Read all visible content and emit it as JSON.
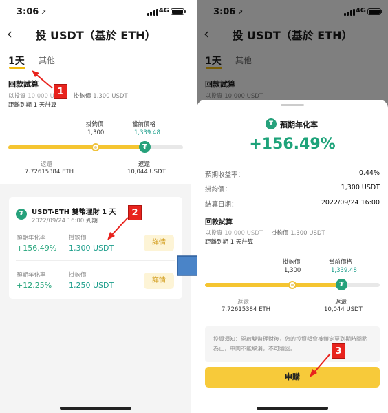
{
  "status": {
    "time": "3:06",
    "network": "4G"
  },
  "nav": {
    "title": "投 USDT（基於 ETH）"
  },
  "tabs": [
    {
      "label": "1天"
    },
    {
      "label": "其他"
    }
  ],
  "calc": {
    "title": "回款試算",
    "invest_label": "以投資",
    "invest_value": "10,000 USDT",
    "hook_label": "掛鉤價",
    "hook_value": "1,300 USDT",
    "expiry_note": "距離到期 1 天計算",
    "hook_price_label": "掛鉤價",
    "hook_price": "1,300",
    "current_price_label": "當前價格",
    "current_price": "1,339.48",
    "return_left_label": "返還",
    "return_left_value": "7.72615384 ETH",
    "return_right_label": "返還",
    "return_right_value": "10,044 USDT"
  },
  "product": {
    "name": "USDT-ETH 雙幣理財 1 天",
    "date": "2022/09/24 16:00",
    "date_suffix": "到期",
    "rows": [
      {
        "apr_label": "預期年化率",
        "apr": "+156.49%",
        "hook_label": "掛鉤價",
        "hook": "1,300 USDT",
        "button": "詳情"
      },
      {
        "apr_label": "預期年化率",
        "apr": "+12.25%",
        "hook_label": "掛鉤價",
        "hook": "1,250 USDT",
        "button": "詳情"
      }
    ]
  },
  "sheet": {
    "header": "預期年化率",
    "apr": "+156.49%",
    "rows": [
      {
        "label": "預期收益率：",
        "value": "0.44%"
      },
      {
        "label": "掛鉤價：",
        "value": "1,300 USDT"
      },
      {
        "label": "結算日期：",
        "value": "2022/09/24 16:00"
      }
    ],
    "calc_title": "回款試算",
    "invest_label": "以投資",
    "invest_value": "10,000 USDT",
    "hook_label": "掛鉤價",
    "hook_value": "1,300 USDT",
    "expiry_note": "距離到期 1 天計算",
    "hook_price_label": "掛鉤價",
    "hook_price": "1,300",
    "current_price_label": "當前價格",
    "current_price": "1,339.48",
    "return_left_label": "返還",
    "return_left_value": "7.72615384 ETH",
    "return_right_label": "返還",
    "return_right_value": "10,044 USDT",
    "note": "投資須知：開啟雙幣理財後，您的投資額會被鎖定至到期時間點為止，中間不能取消，不可贖回。",
    "button": "申購"
  },
  "badges": [
    "1",
    "2",
    "3"
  ],
  "colors": {
    "accent": "#f5c531",
    "teal": "#1c9e8b",
    "annotation_red": "#e8231d",
    "arrow_blue": "#4a84c8"
  },
  "icons": [
    "back-chevron-icon",
    "location-arrow-icon",
    "signal-icon",
    "battery-icon",
    "tether-icon",
    "arrow-right-icon"
  ]
}
